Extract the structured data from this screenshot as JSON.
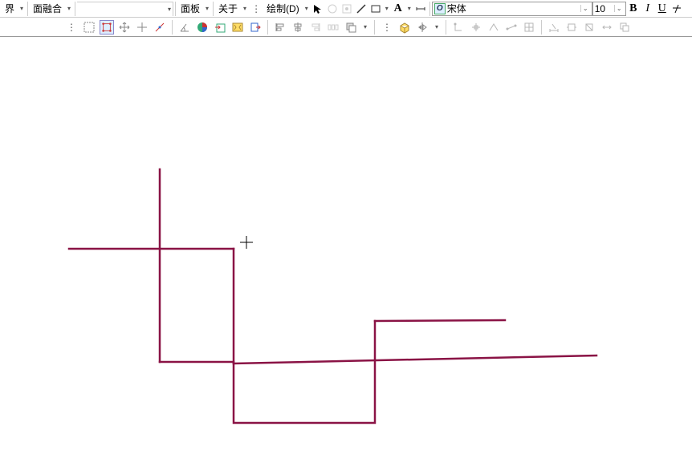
{
  "menus": {
    "boundary": "界",
    "face_merge": "面融合",
    "panel": "面板",
    "about": "关于",
    "draw": "绘制(D)"
  },
  "font": {
    "name": "宋体",
    "size": "10"
  },
  "format": {
    "bold": "B",
    "italic": "I",
    "underline": "U"
  },
  "chart_data": null
}
